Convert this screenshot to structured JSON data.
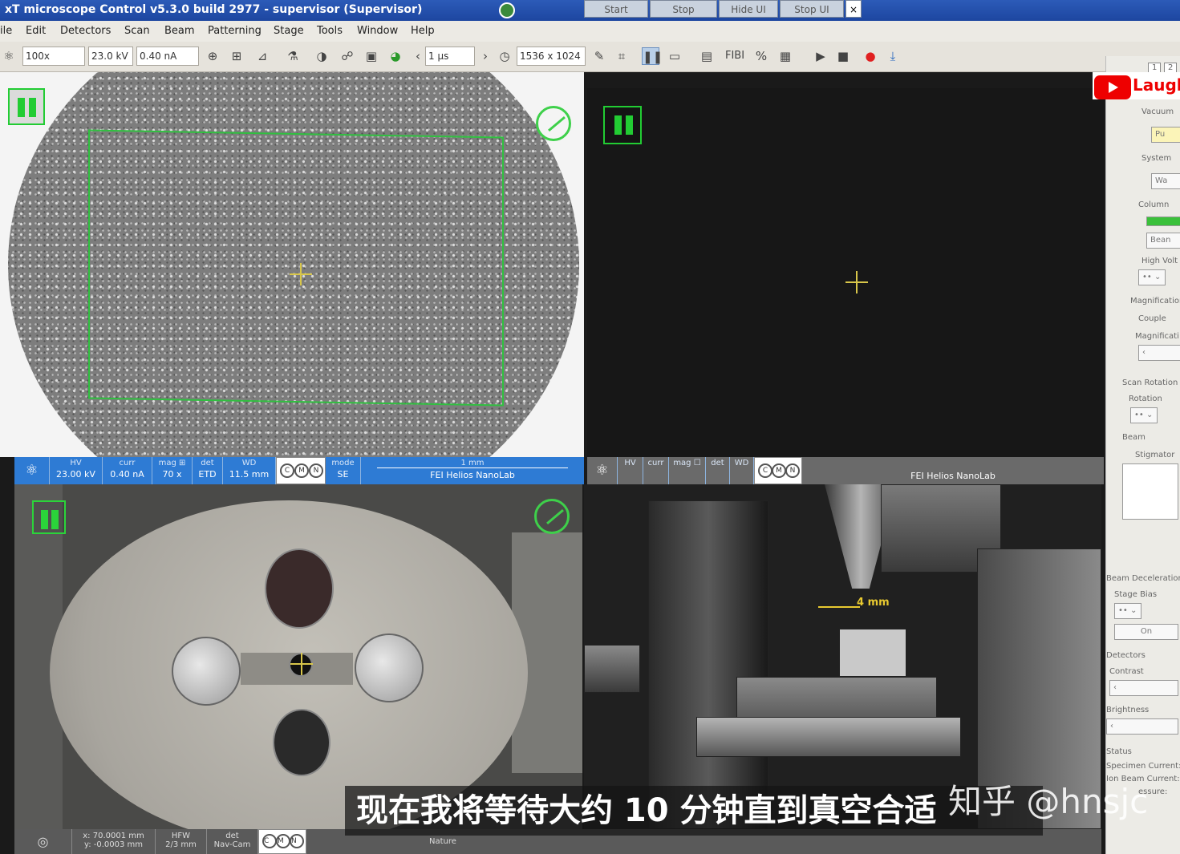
{
  "window": {
    "title": "xT microscope Control v5.3.0 build 2977 - supervisor (Supervisor)",
    "controls": [
      "Start",
      "Stop",
      "Hide UI",
      "Stop UI"
    ],
    "close": "×"
  },
  "menu": [
    "ile",
    "Edit",
    "Detectors",
    "Scan",
    "Beam",
    "Patterning",
    "Stage",
    "Tools",
    "Window",
    "Help"
  ],
  "toolbar": {
    "magnification": "100x",
    "high_voltage": "23.0 kV",
    "current": "0.40 nA",
    "dwell": "1 µs",
    "resolution": "1536 x 1024",
    "icons": [
      "atom-icon",
      "crosshair-icon",
      "box-icon",
      "measure-icon",
      "contrast-icon",
      "detector-icon",
      "image-icon",
      "pie-icon",
      "clock-icon",
      "pause-icon",
      "fibi-icon",
      "play-icon",
      "stop-icon",
      "record-icon",
      "download-icon"
    ],
    "fibi_label": "FIBI"
  },
  "quad1": {
    "databar": {
      "hv_label": "HV",
      "hv": "23.00 kV",
      "curr_label": "curr",
      "curr": "0.40 nA",
      "mag_label": "mag ⊞",
      "mag": "70 x",
      "det_label": "det",
      "det": "ETD",
      "wd_label": "WD",
      "wd": "11.5 mm",
      "mode_label": "mode",
      "mode": "SE",
      "scale": "1 mm",
      "instrument": "FEI Helios NanoLab"
    }
  },
  "quad2": {
    "databar": {
      "hv_label": "HV",
      "curr_label": "curr",
      "mag_label": "mag ☐",
      "det_label": "det",
      "wd_label": "WD",
      "instrument": "FEI Helios NanoLab"
    }
  },
  "quad4": {
    "wd_annotation": "4 mm"
  },
  "bottom_bar": {
    "x": "x: 70.0001 mm",
    "y": "y: -0.0003 mm",
    "hfw_label": "HFW",
    "hfw": "2/3 mm",
    "det_label": "det",
    "det": "Nav-Cam",
    "mode": "Nature"
  },
  "right_panel": {
    "view_buttons": [
      "1",
      "2"
    ],
    "vacuum_label": "Vacuum",
    "pump_button": "Pu",
    "system_label": "System",
    "wake_button": "Wa",
    "column_label": "Column",
    "beam_button": "Bean",
    "high_voltage_label": "High Volt",
    "magnification_label": "Magnification",
    "couple_label": "Couple",
    "magnification2_label": "Magnificati",
    "scan_rotation_label": "Scan Rotation",
    "rotation_label": "Rotation",
    "beam_label": "Beam",
    "stigmator_label": "Stigmator",
    "beam_decel_label": "Beam Deceleration",
    "stage_bias_label": "Stage Bias",
    "on_button": "On",
    "detectors_label": "Detectors",
    "contrast_label": "Contrast",
    "brightness_label": "Brightness",
    "status_label": "Status",
    "specimen_current": "Specimen Current:",
    "ion_beam_current": "Ion Beam Current:",
    "pressure": "essure:"
  },
  "overlay": {
    "youtube_text": "Laugh",
    "subtitle": "现在我将等待大约 10 分钟直到真空合适",
    "watermark": "知乎 @hnsjc"
  },
  "colors": {
    "titlebar": "#2c5bb8",
    "databar": "#2e7bd4",
    "frame_green": "#30c040",
    "crosshair": "#d8c64a"
  }
}
